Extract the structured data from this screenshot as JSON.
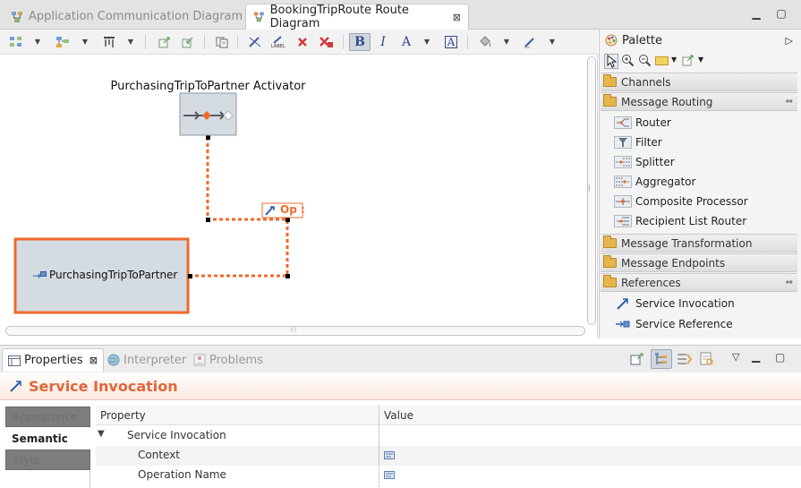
{
  "editor_tabs": [
    {
      "label": "Application Communication Diagram",
      "icon": "diagram-icon",
      "active": false
    },
    {
      "label": "BookingTripRoute Route Diagram",
      "icon": "route-diagram-icon",
      "active": true
    }
  ],
  "toolbar": {
    "buttons": [
      "select-tool-icon",
      "layout-icon",
      "align-icon",
      "export-icon",
      "import-icon",
      "copy-icon",
      "hide-connector-icon",
      "hide-label-icon",
      "delete-icon",
      "delete-from-model-icon",
      "bold-icon",
      "italic-icon",
      "font-color-icon",
      "font-icon",
      "fill-color-icon",
      "line-color-icon"
    ],
    "bold_label": "B",
    "italic_label": "I",
    "font_color_label": "A",
    "font_label": "A"
  },
  "diagram": {
    "activator_label": "PurchasingTripToPartner Activator",
    "service_label": "PurchasingTripToPartner",
    "service_prefix": "→",
    "op_label": "Op :",
    "colors": {
      "accent": "#ef6a2e",
      "node_fill": "#d4dbe1",
      "node_border": "#8d99a6"
    }
  },
  "palette": {
    "title": "Palette",
    "drawers": [
      {
        "label": "Channels",
        "expanded": false,
        "items": []
      },
      {
        "label": "Message Routing",
        "expanded": true,
        "items": [
          {
            "label": "Router",
            "icon": "router-icon"
          },
          {
            "label": "Filter",
            "icon": "filter-icon"
          },
          {
            "label": "Splitter",
            "icon": "splitter-icon"
          },
          {
            "label": "Aggregator",
            "icon": "aggregator-icon"
          },
          {
            "label": "Composite Processor",
            "icon": "composite-processor-icon"
          },
          {
            "label": "Recipient List Router",
            "icon": "recipient-list-router-icon"
          }
        ]
      },
      {
        "label": "Message Transformation",
        "expanded": false,
        "items": []
      },
      {
        "label": "Message Endpoints",
        "expanded": false,
        "items": []
      },
      {
        "label": "References",
        "expanded": true,
        "items": [
          {
            "label": "Service Invocation",
            "icon": "service-invocation-icon"
          },
          {
            "label": "Service Reference",
            "icon": "service-reference-icon"
          }
        ]
      }
    ]
  },
  "properties": {
    "tabs": [
      {
        "label": "Properties",
        "active": true
      },
      {
        "label": "Interpreter",
        "active": false
      },
      {
        "label": "Problems",
        "active": false
      }
    ],
    "title": "Service Invocation",
    "section_tabs": [
      "Appearance",
      "Semantic",
      "Style"
    ],
    "selected_section": "Semantic",
    "columns": [
      "Property",
      "Value"
    ],
    "rows": [
      {
        "label": "Service Invocation",
        "value": ""
      },
      {
        "label": "Context",
        "value": ""
      },
      {
        "label": "Operation Name",
        "value": ""
      }
    ]
  }
}
